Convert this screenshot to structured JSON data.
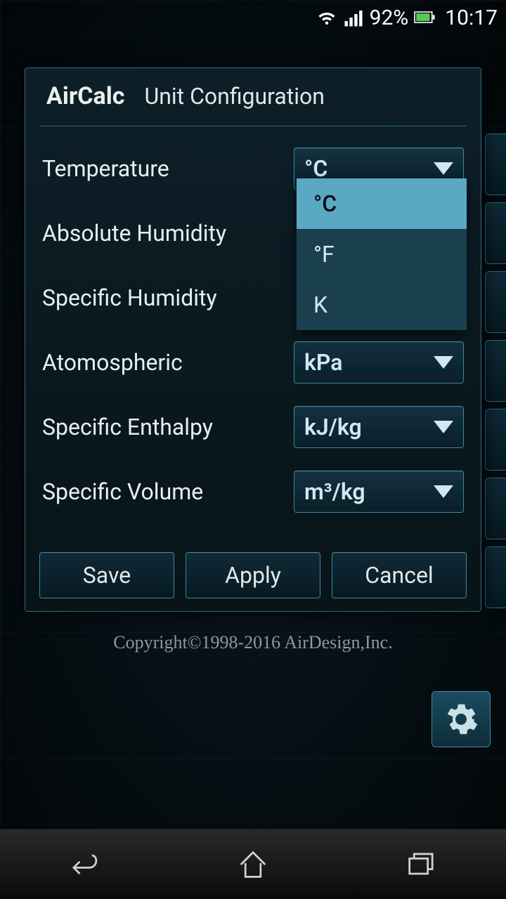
{
  "status": {
    "battery": "92%",
    "time": "10:17"
  },
  "dialog": {
    "app_name": "AirCalc",
    "title": "Unit Configuration",
    "rows": [
      {
        "label": "Temperature",
        "value": "°C"
      },
      {
        "label": "Absolute Humidity",
        "value": ""
      },
      {
        "label": "Specific Humidity",
        "value": ""
      },
      {
        "label": "Atomospheric",
        "value": "kPa"
      },
      {
        "label": "Specific Enthalpy",
        "value": "kJ/kg"
      },
      {
        "label": "Specific Volume",
        "value": "m³/kg"
      }
    ],
    "dropdown_options": [
      "°C",
      "°F",
      "K"
    ],
    "buttons": {
      "save": "Save",
      "apply": "Apply",
      "cancel": "Cancel"
    }
  },
  "footer": {
    "copyright": "Copyright©1998-2016 AirDesign,Inc."
  }
}
